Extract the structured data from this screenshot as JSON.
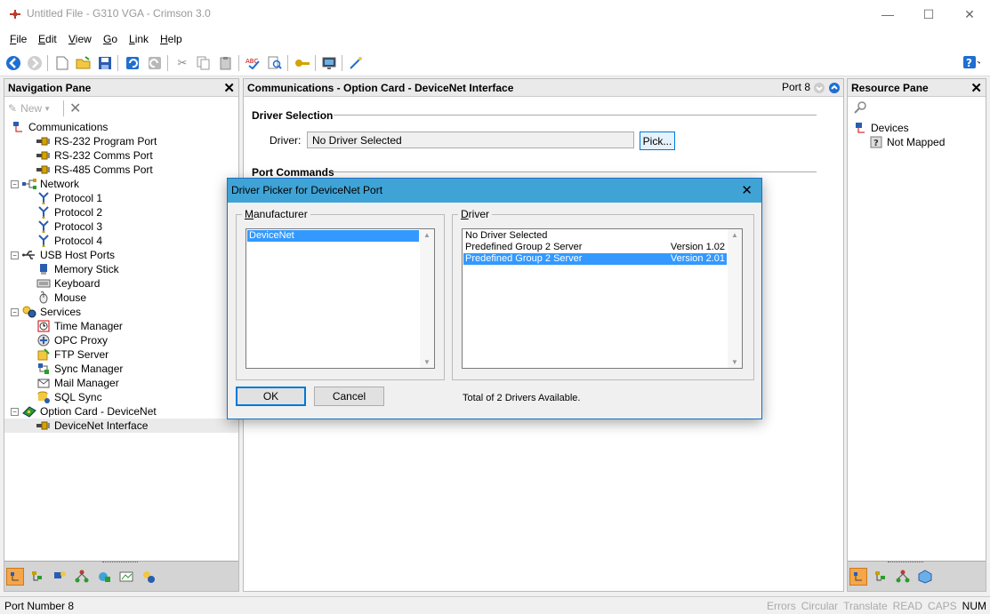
{
  "window": {
    "title": "Untitled File - G310 VGA - Crimson 3.0",
    "minimize_glyph": "—",
    "maximize_glyph": "☐",
    "close_glyph": "✕"
  },
  "menu": {
    "file": {
      "key": "F",
      "rest": "ile"
    },
    "edit": {
      "key": "E",
      "rest": "dit"
    },
    "view": {
      "key": "V",
      "rest": "iew"
    },
    "go": {
      "key": "G",
      "rest": "o"
    },
    "link": {
      "key": "L",
      "rest": "ink"
    },
    "help": {
      "key": "H",
      "rest": "elp"
    }
  },
  "toolbar": {
    "icons": [
      "back-icon",
      "forward-icon",
      "new-file-icon",
      "open-folder-icon",
      "save-icon",
      "undo-icon",
      "redo-icon",
      "cut-icon",
      "copy-icon",
      "paste-icon",
      "spell-check-icon",
      "find-icon",
      "key-icon",
      "monitor-icon",
      "wand-icon",
      "help-icon"
    ]
  },
  "nav_pane": {
    "title": "Navigation Pane",
    "new_label": "New",
    "tree": [
      {
        "label": "Communications",
        "level": 0,
        "expander": "",
        "icon": "communications-icon"
      },
      {
        "label": "RS-232 Program Port",
        "level": 1,
        "expander": "",
        "icon": "port-icon"
      },
      {
        "label": "RS-232 Comms Port",
        "level": 1,
        "expander": "",
        "icon": "port-icon"
      },
      {
        "label": "RS-485 Comms Port",
        "level": 1,
        "expander": "",
        "icon": "port-icon"
      },
      {
        "label": "Network",
        "level": 0,
        "expander": "−",
        "icon": "network-icon"
      },
      {
        "label": "Protocol 1",
        "level": 1,
        "expander": "",
        "icon": "protocol-icon"
      },
      {
        "label": "Protocol 2",
        "level": 1,
        "expander": "",
        "icon": "protocol-icon"
      },
      {
        "label": "Protocol 3",
        "level": 1,
        "expander": "",
        "icon": "protocol-icon"
      },
      {
        "label": "Protocol 4",
        "level": 1,
        "expander": "",
        "icon": "protocol-icon"
      },
      {
        "label": "USB Host Ports",
        "level": 0,
        "expander": "−",
        "icon": "usb-icon"
      },
      {
        "label": "Memory Stick",
        "level": 1,
        "expander": "",
        "icon": "memory-stick-icon"
      },
      {
        "label": "Keyboard",
        "level": 1,
        "expander": "",
        "icon": "keyboard-icon"
      },
      {
        "label": "Mouse",
        "level": 1,
        "expander": "",
        "icon": "mouse-icon"
      },
      {
        "label": "Services",
        "level": 0,
        "expander": "−",
        "icon": "services-icon"
      },
      {
        "label": "Time Manager",
        "level": 1,
        "expander": "",
        "icon": "clock-icon"
      },
      {
        "label": "OPC Proxy",
        "level": 1,
        "expander": "",
        "icon": "opc-icon"
      },
      {
        "label": "FTP Server",
        "level": 1,
        "expander": "",
        "icon": "ftp-icon"
      },
      {
        "label": "Sync Manager",
        "level": 1,
        "expander": "",
        "icon": "sync-icon"
      },
      {
        "label": "Mail Manager",
        "level": 1,
        "expander": "",
        "icon": "mail-icon"
      },
      {
        "label": "SQL Sync",
        "level": 1,
        "expander": "",
        "icon": "sql-icon"
      },
      {
        "label": "Option Card - DeviceNet",
        "level": 0,
        "expander": "−",
        "icon": "option-card-icon"
      },
      {
        "label": "DeviceNet Interface",
        "level": 1,
        "expander": "",
        "icon": "port-icon",
        "selected": true
      }
    ]
  },
  "center": {
    "header": "Communications - Option Card - DeviceNet Interface",
    "port_label": "Port 8",
    "driver_section": "Driver Selection",
    "driver_label": "Driver:",
    "driver_value": "No Driver Selected",
    "pick_label": "Pick...",
    "port_commands_section": "Port Commands"
  },
  "resource_pane": {
    "title": "Resource Pane",
    "devices_label": "Devices",
    "not_mapped_label": "Not Mapped"
  },
  "dialog": {
    "title": "Driver Picker for DeviceNet Port",
    "manufacturer_key": "M",
    "manufacturer_rest": "anufacturer",
    "driver_key": "D",
    "driver_rest": "river",
    "manufacturers": [
      {
        "name": "DeviceNet",
        "selected": true
      }
    ],
    "drivers": [
      {
        "name": "No Driver Selected",
        "version": "",
        "selected": false
      },
      {
        "name": "Predefined Group 2 Server",
        "version": "Version 1.02",
        "selected": false
      },
      {
        "name": "Predefined Group 2 Server",
        "version": "Version 2.01",
        "selected": true
      }
    ],
    "ok_label": "OK",
    "cancel_label": "Cancel",
    "total_text": "Total of 2 Drivers Available."
  },
  "status": {
    "left": "Port Number 8",
    "indicators": [
      {
        "label": "Errors",
        "active": false
      },
      {
        "label": "Circular",
        "active": false
      },
      {
        "label": "Translate",
        "active": false
      },
      {
        "label": "READ",
        "active": false
      },
      {
        "label": "CAPS",
        "active": false
      },
      {
        "label": "NUM",
        "active": true
      }
    ]
  },
  "colors": {
    "accent": "#3fa3d6",
    "selection": "#3399ff",
    "pane_border": "#bcbcbc"
  }
}
